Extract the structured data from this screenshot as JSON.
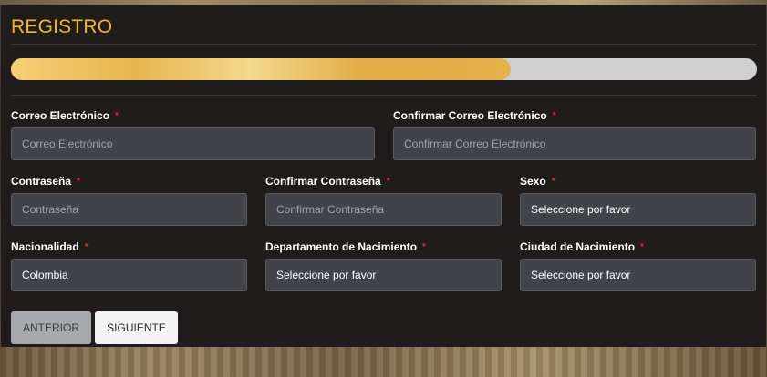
{
  "form": {
    "title": "REGISTRO",
    "progress_percent": 67,
    "required_marker": "*",
    "fields": {
      "email": {
        "label": "Correo Electrónico",
        "value": "",
        "placeholder": "Correo Electrónico"
      },
      "email_confirm": {
        "label": "Confirmar Correo Electrónico",
        "value": "",
        "placeholder": "Confirmar Correo Electrónico"
      },
      "password": {
        "label": "Contraseña",
        "value": "",
        "placeholder": "Contraseña"
      },
      "password_confirm": {
        "label": "Confirmar Contraseña",
        "value": "",
        "placeholder": "Confirmar Contraseña"
      },
      "sex": {
        "label": "Sexo",
        "value": "Seleccione por favor"
      },
      "nationality": {
        "label": "Nacionalidad",
        "value": "Colombia"
      },
      "birth_department": {
        "label": "Departamento de Nacimiento",
        "value": "Seleccione por favor"
      },
      "birth_city": {
        "label": "Ciudad de Nacimiento",
        "value": "Seleccione por favor"
      }
    },
    "buttons": {
      "previous": "ANTERIOR",
      "next": "SIGUIENTE"
    }
  },
  "colors": {
    "title": "#f5b623",
    "panel_bg": "#201c1b",
    "required": "#e0322e",
    "input_bg": "#414349",
    "progress_track": "#cfcfcf"
  }
}
